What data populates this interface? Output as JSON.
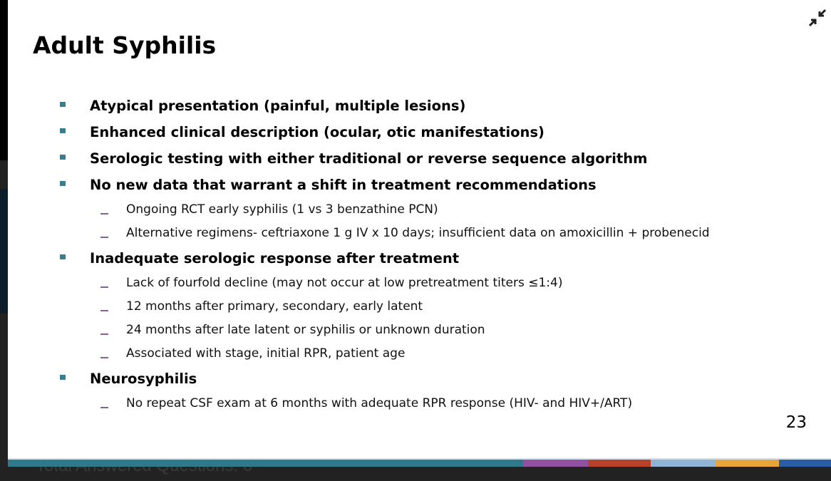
{
  "background_text": "Total Answered Questions: 6",
  "slide": {
    "title": "Adult Syphilis",
    "page_number": "23",
    "collapse_icon": "collapse-arrows-icon",
    "bullets": [
      {
        "level": 1,
        "text": "Atypical presentation (painful, multiple lesions)"
      },
      {
        "level": 1,
        "text": "Enhanced clinical description (ocular, otic manifestations)"
      },
      {
        "level": 1,
        "text": "Serologic testing with either traditional or reverse sequence algorithm"
      },
      {
        "level": 1,
        "text": "No new data that warrant a shift in treatment recommendations"
      },
      {
        "level": 2,
        "text": "Ongoing RCT early syphilis (1 vs 3 benzathine PCN)"
      },
      {
        "level": 2,
        "text": "Alternative regimens- ceftriaxone 1 g IV x 10 days; insufficient data on amoxicillin + probenecid"
      },
      {
        "level": 1,
        "text": "Inadequate serologic response after treatment"
      },
      {
        "level": 2,
        "text": "Lack of fourfold decline (may not occur at low pretreatment titers ≤1:4)"
      },
      {
        "level": 2,
        "text": "12 months after primary, secondary, early latent"
      },
      {
        "level": 2,
        "text": "24 months after late latent or syphilis or unknown duration"
      },
      {
        "level": 2,
        "text": "Associated with stage, initial RPR, patient age"
      },
      {
        "level": 1,
        "text": "Neurosyphilis"
      },
      {
        "level": 2,
        "text": "No repeat CSF exam at 6 months with adequate RPR response (HIV- and HIV+/ART)"
      }
    ],
    "colors": {
      "bullet": "#3a7d8e",
      "sub_dash": "#8e5a9e"
    },
    "strip_colors": [
      "#2f7a8a",
      "#9150a0",
      "#b8412a",
      "#8fb4d6",
      "#e9a43c",
      "#2a5fa8"
    ]
  }
}
